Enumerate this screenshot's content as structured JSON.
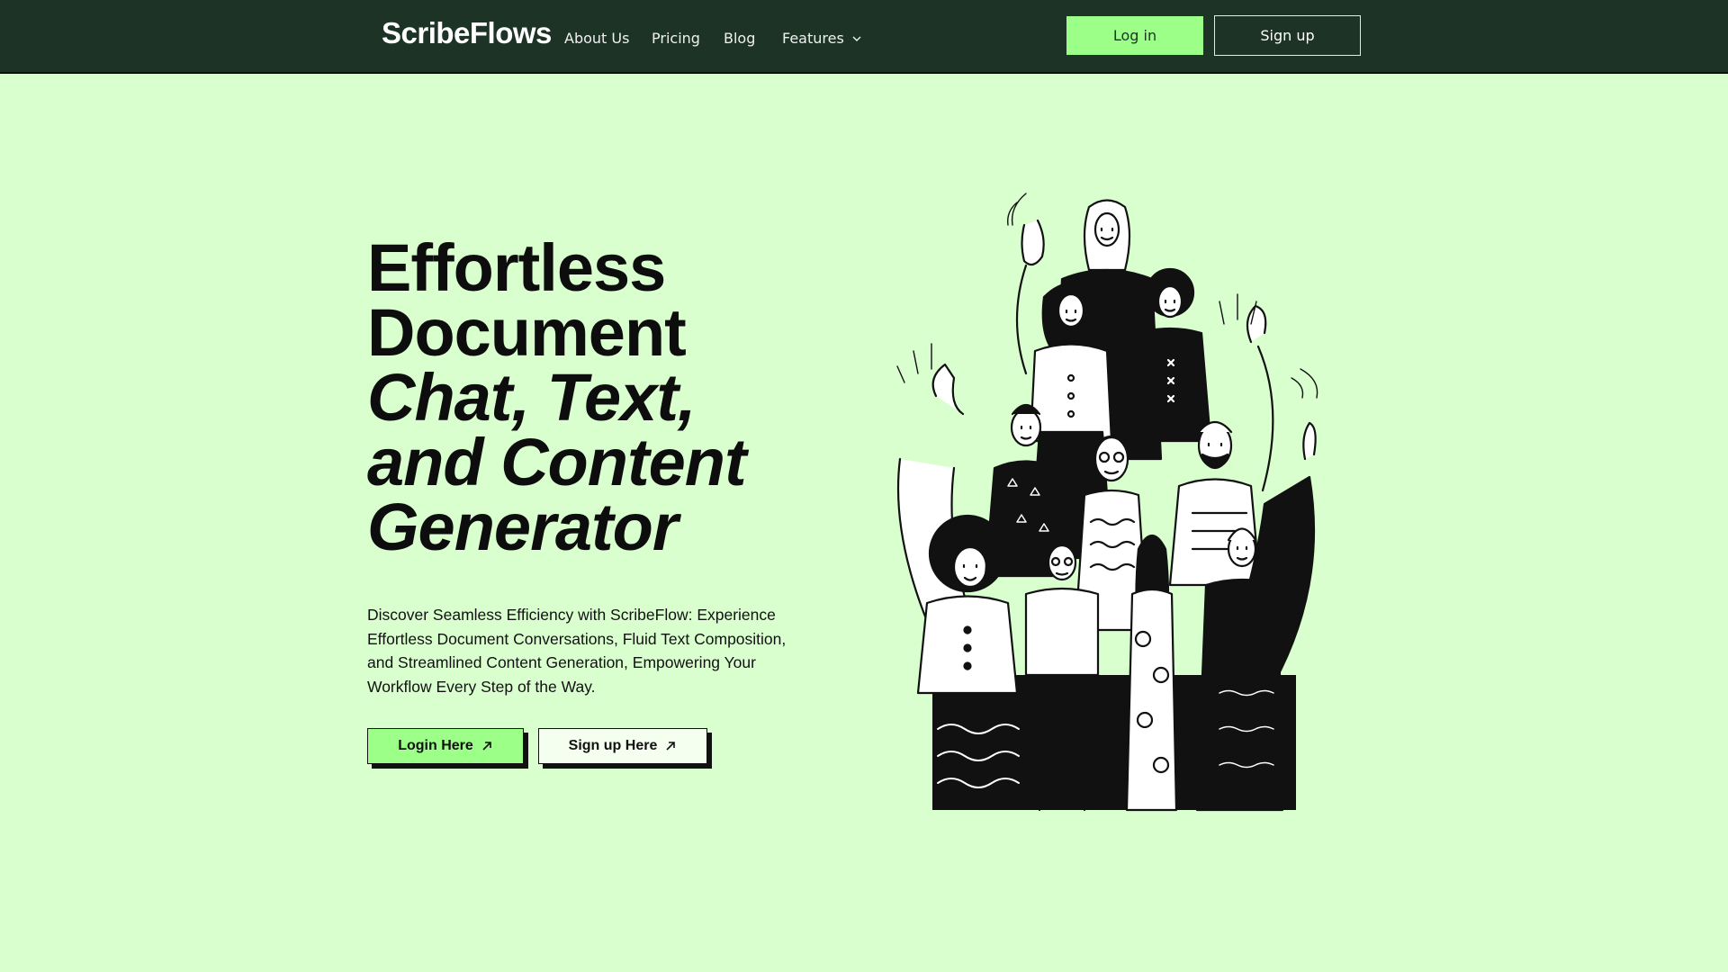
{
  "header": {
    "logo": "ScribeFlows",
    "nav": [
      {
        "label": "About Us"
      },
      {
        "label": "Pricing"
      },
      {
        "label": "Blog"
      },
      {
        "label": "Features"
      }
    ],
    "login_label": "Log in",
    "signup_label": "Sign up"
  },
  "hero": {
    "title_line1": "Effortless",
    "title_line2": "Document",
    "title_line3": "Chat, Text,",
    "title_line4": "and Content",
    "title_line5": "Generator",
    "description": "Discover Seamless Efficiency with ScribeFlow: Experience Effortless Document Conversations, Fluid Text Composition, and Streamlined Content Generation, Empowering Your Workflow Every Step of the Way.",
    "login_cta": "Login Here",
    "signup_cta": "Sign up Here"
  },
  "colors": {
    "background": "#d9ffcf",
    "header_bg": "#1c3326",
    "accent_green": "#9cff88"
  },
  "icons": {
    "features_dropdown": "chevron-down-icon",
    "cta_arrow": "arrow-up-right-icon"
  }
}
